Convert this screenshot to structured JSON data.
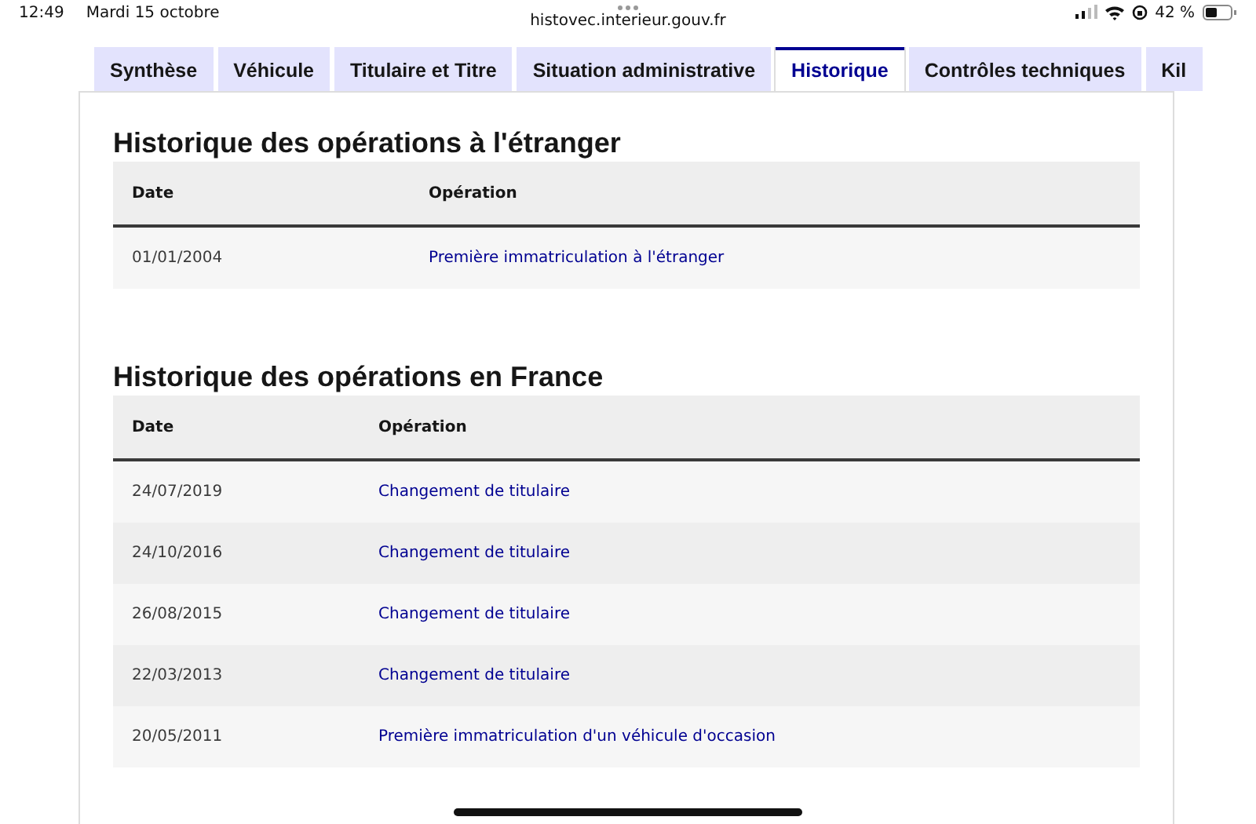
{
  "status_bar": {
    "time": "12:49",
    "date": "Mardi 15 octobre",
    "battery": "42 %",
    "url": "histovec.interieur.gouv.fr"
  },
  "tabs": [
    {
      "label": "Synthèse",
      "selected": false
    },
    {
      "label": "Véhicule",
      "selected": false
    },
    {
      "label": "Titulaire et Titre",
      "selected": false
    },
    {
      "label": "Situation administrative",
      "selected": false
    },
    {
      "label": "Historique",
      "selected": true
    },
    {
      "label": "Contrôles techniques",
      "selected": false
    },
    {
      "label": "Kil",
      "selected": false
    }
  ],
  "sections": [
    {
      "title": "Historique des opérations à l'étranger",
      "columns": [
        "Date",
        "Opération"
      ],
      "rows": [
        {
          "date": "01/01/2004",
          "operation": "Première immatriculation à l'étranger"
        }
      ]
    },
    {
      "title": "Historique des opérations en France",
      "columns": [
        "Date",
        "Opération"
      ],
      "rows": [
        {
          "date": "24/07/2019",
          "operation": "Changement de titulaire"
        },
        {
          "date": "24/10/2016",
          "operation": "Changement de titulaire"
        },
        {
          "date": "26/08/2015",
          "operation": "Changement de titulaire"
        },
        {
          "date": "22/03/2013",
          "operation": "Changement de titulaire"
        },
        {
          "date": "20/05/2011",
          "operation": "Première immatriculation d'un véhicule d'occasion"
        }
      ]
    }
  ]
}
